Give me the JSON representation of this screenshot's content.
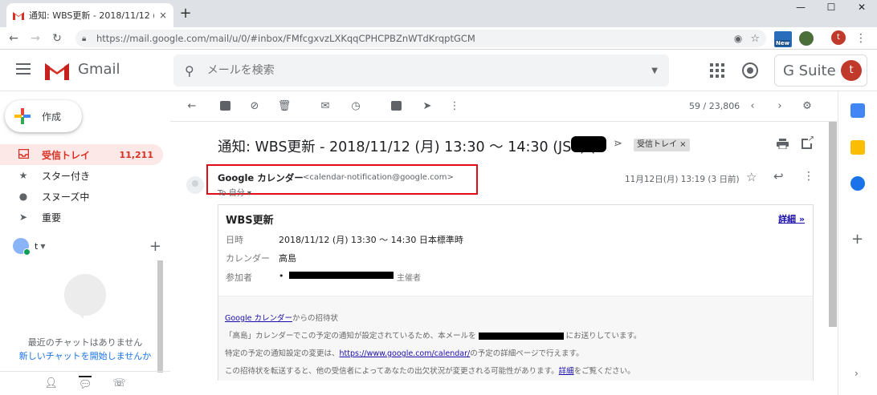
{
  "browser": {
    "tab_title": "通知: WBS更新 - 2018/11/12 (月)",
    "tab_close": "×",
    "new_tab": "+",
    "url": "https://mail.google.com/mail/u/0/#inbox/FMfcgxvzLXKqqCPHCPBZnWTdKrqptGCM",
    "profile_initial": "t",
    "ext_badge": "New",
    "window_controls": [
      "—",
      "☐",
      "✕"
    ]
  },
  "header": {
    "app_name": "Gmail",
    "search_placeholder": "メールを検索",
    "gsuite_label": "G Suite",
    "avatar_initial": "t"
  },
  "sidebar": {
    "compose_label": "作成",
    "items": [
      {
        "label": "受信トレイ",
        "count": "11,211",
        "icon": "inbox-icon"
      },
      {
        "label": "スター付き",
        "count": "",
        "icon": "star-icon"
      },
      {
        "label": "スヌーズ中",
        "count": "",
        "icon": "clock-icon"
      },
      {
        "label": "重要",
        "count": "",
        "icon": "label-important-icon"
      }
    ],
    "hangouts_user": "t",
    "chat_empty": "最近のチャットはありません",
    "chat_start": "新しいチャットを開始しませんか"
  },
  "toolbar": {
    "pager": "59 / 23,806"
  },
  "message": {
    "subject": "通知: WBS更新 - 2018/11/12 (月) 13:30 〜 14:30 (JST) (",
    "label_chip": "受信トレイ ×",
    "sender_name": "Google カレンダー",
    "sender_email": "<calendar-notification@google.com>",
    "to_line": "To 自分 ▾",
    "datetime": "11月12日(月) 13:19 (3 日前)"
  },
  "event": {
    "title": "WBS更新",
    "details_link": "詳細 »",
    "rows": [
      {
        "key": "日時",
        "value": "2018/11/12 (月) 13:30 〜 14:30 日本標準時"
      },
      {
        "key": "カレンダー",
        "value": "高島"
      },
      {
        "key": "参加者",
        "value": "•"
      }
    ],
    "organizer": "主催者",
    "footer": {
      "invite_link": "Google カレンダー",
      "invite_text": "からの招待状",
      "line2_a": "「高島」カレンダーでこの予定の通知が設定されているため、本メールを",
      "line2_b": "にお送りしています。",
      "line3_a": "特定の予定の通知設定の変更は、",
      "line3_link": "https://www.google.com/calendar/",
      "line3_b": "の予定の詳細ページで行えます。",
      "line4_a": "この招待状を転送すると、他の受信者によってあなたの出欠状況が変更される可能性があります。",
      "line4_link": "詳細",
      "line4_b": "をご覧ください。"
    }
  },
  "colors": {
    "accent_red": "#d93025",
    "highlight_box": "#e00d14",
    "link": "#1a0dab"
  }
}
